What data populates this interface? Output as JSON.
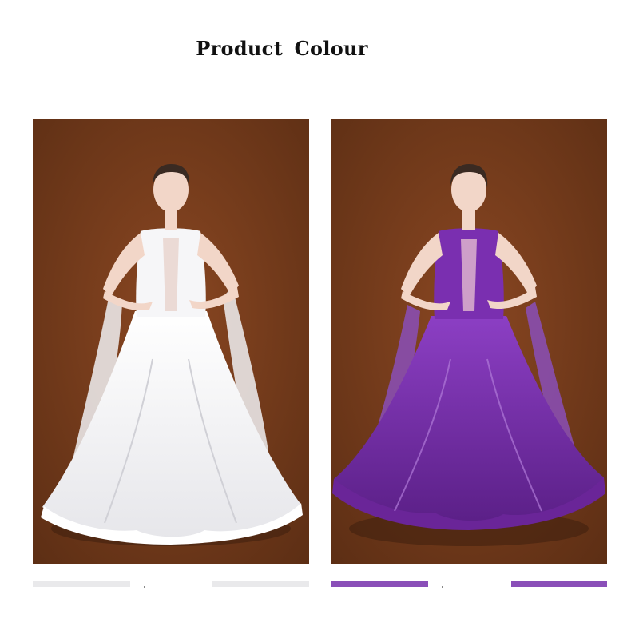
{
  "header": {
    "title": "Product  Colour"
  },
  "products": [
    {
      "colour_name": "white",
      "dress_color": "#f4f4f4",
      "dress_shade": "#d8d8dc",
      "bar_color": "#e9e9eb"
    },
    {
      "colour_name": "purple",
      "dress_color": "#7a2fb0",
      "dress_shade": "#5a1f86",
      "bar_color": "#8a4fb8"
    }
  ],
  "colors": {
    "backdrop": "#7a3e1c",
    "backdrop_dark": "#4f2710",
    "skin": "#f2d6c8",
    "hair": "#3a2a22"
  }
}
